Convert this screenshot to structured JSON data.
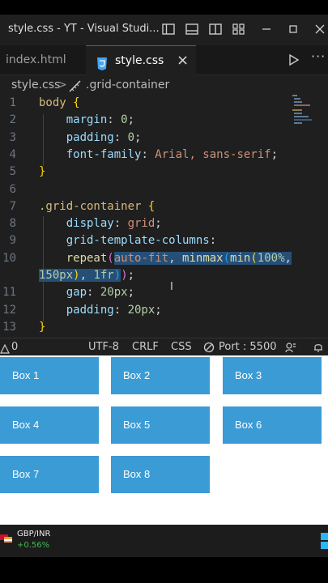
{
  "window": {
    "title": "style.css - YT - Visual Studi..."
  },
  "tabs": [
    {
      "label": "index.html",
      "active": false
    },
    {
      "label": "style.css",
      "active": true,
      "close": "×"
    }
  ],
  "breadcrumb": {
    "file": "style.css",
    "separator": ">",
    "symbol": ".grid-container"
  },
  "editor": {
    "lines": [
      {
        "num": "1",
        "segs": [
          {
            "t": "body",
            "c": "#d7ba7d"
          },
          {
            "t": " {",
            "c": "#ffd700"
          }
        ]
      },
      {
        "num": "2",
        "segs": [
          {
            "t": "    margin",
            "c": "#9cdcfe"
          },
          {
            "t": ": ",
            "c": "#d4d4d4"
          },
          {
            "t": "0",
            "c": "#b5cea8"
          },
          {
            "t": ";",
            "c": "#d4d4d4"
          }
        ]
      },
      {
        "num": "3",
        "segs": [
          {
            "t": "    padding",
            "c": "#9cdcfe"
          },
          {
            "t": ": ",
            "c": "#d4d4d4"
          },
          {
            "t": "0",
            "c": "#b5cea8"
          },
          {
            "t": ";",
            "c": "#d4d4d4"
          }
        ]
      },
      {
        "num": "4",
        "segs": [
          {
            "t": "    font-family",
            "c": "#9cdcfe"
          },
          {
            "t": ": ",
            "c": "#d4d4d4"
          },
          {
            "t": "Arial, sans-serif",
            "c": "#ce9178"
          },
          {
            "t": ";",
            "c": "#d4d4d4"
          }
        ]
      },
      {
        "num": "5",
        "segs": [
          {
            "t": "}",
            "c": "#ffd700"
          }
        ]
      },
      {
        "num": "6",
        "segs": []
      },
      {
        "num": "7",
        "segs": [
          {
            "t": ".grid-container",
            "c": "#d7ba7d"
          },
          {
            "t": " {",
            "c": "#ffd700"
          }
        ]
      },
      {
        "num": "8",
        "segs": [
          {
            "t": "    display",
            "c": "#9cdcfe"
          },
          {
            "t": ": ",
            "c": "#d4d4d4"
          },
          {
            "t": "grid",
            "c": "#ce9178"
          },
          {
            "t": ";",
            "c": "#d4d4d4"
          }
        ]
      },
      {
        "num": "9",
        "segs": [
          {
            "t": "    grid-template-columns",
            "c": "#9cdcfe"
          },
          {
            "t": ":",
            "c": "#d4d4d4"
          }
        ]
      },
      {
        "num": "10",
        "segs": [
          {
            "t": "    repeat",
            "c": "#dcdcaa"
          },
          {
            "t": "(",
            "c": "#da70d6"
          },
          {
            "t": "auto-fit",
            "c": "#ce9178",
            "sel": true
          },
          {
            "t": ", ",
            "c": "#d4d4d4",
            "sel": true
          },
          {
            "t": "minmax",
            "c": "#dcdcaa",
            "sel": true
          },
          {
            "t": "(",
            "c": "#179fff",
            "sel": true
          },
          {
            "t": "min",
            "c": "#dcdcaa",
            "sel": true
          },
          {
            "t": "(",
            "c": "#ffd700",
            "sel": true
          },
          {
            "t": "100%",
            "c": "#b5cea8",
            "sel": true
          },
          {
            "t": ",",
            "c": "#d4d4d4",
            "sel": true
          }
        ]
      },
      {
        "num": "",
        "segs": [
          {
            "t": "150px",
            "c": "#b5cea8",
            "sel": true
          },
          {
            "t": ")",
            "c": "#ffd700",
            "sel": true
          },
          {
            "t": ", ",
            "c": "#d4d4d4",
            "sel": true
          },
          {
            "t": "1fr",
            "c": "#b5cea8",
            "sel": true
          },
          {
            "t": ")",
            "c": "#179fff",
            "sel": true
          },
          {
            "t": ")",
            "c": "#da70d6"
          },
          {
            "t": ";",
            "c": "#d4d4d4"
          }
        ]
      },
      {
        "num": "11",
        "segs": [
          {
            "t": "    gap",
            "c": "#9cdcfe"
          },
          {
            "t": ": ",
            "c": "#d4d4d4"
          },
          {
            "t": "20px",
            "c": "#b5cea8"
          },
          {
            "t": ";",
            "c": "#d4d4d4"
          }
        ]
      },
      {
        "num": "12",
        "segs": [
          {
            "t": "    padding",
            "c": "#9cdcfe"
          },
          {
            "t": ": ",
            "c": "#d4d4d4"
          },
          {
            "t": "20px",
            "c": "#b5cea8"
          },
          {
            "t": ";",
            "c": "#d4d4d4"
          }
        ]
      },
      {
        "num": "13",
        "segs": [
          {
            "t": "}",
            "c": "#ffd700"
          }
        ]
      }
    ]
  },
  "statusbar": {
    "problems": "0",
    "encoding": "UTF-8",
    "eol": "CRLF",
    "language": "CSS",
    "port": "Port : 5500"
  },
  "preview": {
    "boxes": [
      "Box 1",
      "Box 2",
      "Box 3",
      "Box 4",
      "Box 5",
      "Box 6",
      "Box 7",
      "Box 8"
    ]
  },
  "taskbar": {
    "ticker": "GBP/INR",
    "change": "+0.56%"
  },
  "colors": {
    "accent": "#0078d4",
    "box": "#3a9bd5",
    "selection": "#264f78",
    "css_icon": "#42a5f5",
    "up": "#3fb950"
  },
  "icons": [
    "layout-sidebar-left-icon",
    "layout-panel-icon",
    "layout-sidebar-right-icon",
    "customize-layout-icon",
    "minimize-icon",
    "maximize-icon",
    "close-icon",
    "css-file-icon",
    "run-icon",
    "more-icon",
    "warning-icon",
    "broadcast-icon",
    "feedback-icon",
    "bell-icon"
  ]
}
